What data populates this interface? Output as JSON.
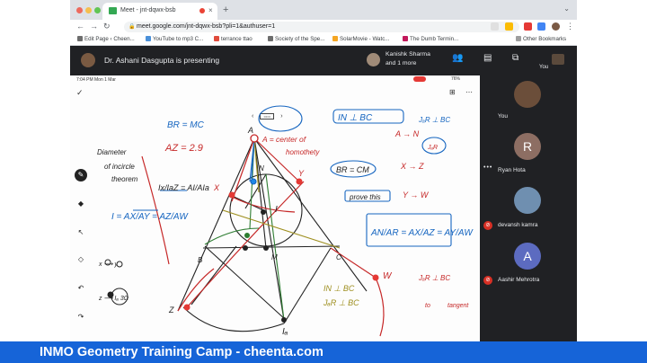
{
  "browser": {
    "tab_title": "Meet - jnt-dqwx-bsb",
    "tab_close": "×",
    "new_tab": "+",
    "url": "meet.google.com/jnt-dqwx-bsb?pli=1&authuser=1",
    "bookmarks": [
      {
        "label": "Edit Page ‹ Cheen...",
        "color": "#6d6d6d"
      },
      {
        "label": "YouTube to mp3 C...",
        "color": "#4a90d9"
      },
      {
        "label": "terrance ttao",
        "color": "#e04b3c"
      },
      {
        "label": "Society of the Spe...",
        "color": "#6d6d6d"
      },
      {
        "label": "SolarMovie - Watc...",
        "color": "#f5a623"
      },
      {
        "label": "The Dumb Termin...",
        "color": "#c2185b"
      }
    ],
    "other_bookmarks": "Other Bookmarks"
  },
  "meet": {
    "presenting_text": "Dr. Ashani Dasgupta is presenting",
    "pinned_line1": "Kanishk Sharma",
    "pinned_line2": "and 1 more",
    "you_label": "You",
    "participants": [
      {
        "name": "You",
        "initial": "",
        "muted": false,
        "avatar_color": "#6b4e3a"
      },
      {
        "name": "Ryan Hota",
        "initial": "R",
        "muted": false,
        "avatar_color": "#8d6e63"
      },
      {
        "name": "devansh kamra",
        "initial": "",
        "muted": true,
        "avatar_color": "#6f8fb0"
      },
      {
        "name": "Aashir Mehrotra",
        "initial": "A",
        "muted": true,
        "avatar_color": "#5c6bc0"
      }
    ]
  },
  "board": {
    "status_time": "7:04 PM   Mon 1 Mar",
    "battery": "76%",
    "pager_prev": "‹",
    "pager_next": "›",
    "notes": {
      "br_mc": "BR = MC",
      "az_val": "AZ = 2.9",
      "a_center": "A = center of",
      "homothety": "homothety",
      "br_cm": "BR = CM",
      "in_perp": "IN ⊥ BC",
      "ja_perp": "JₐR ⊥ BC",
      "a_to_n": "A → N",
      "x_to_z": "X → Z",
      "prove_this": "prove this",
      "y_to_w": "Y → W",
      "ja_label": "JₐR",
      "diameter": "Diameter",
      "of_incircle": "of incircle",
      "theorem": "theorem",
      "ix_frac": "Ix/IaZ = AI/AIa",
      "ax_frac": "I = AX/AY = AZ/AW",
      "an_ar": "AN/AR = AX/AZ = AY/AW",
      "in_bc2": "IN ⊥ BC",
      "jar_bc2": "JₐR ⊥ BC",
      "jar_bc3": "JₐR ⊥ BC",
      "tangent": "tangent",
      "to": "to",
      "ia_label": "Iₐ",
      "i_label": "I",
      "m_label": "M",
      "b_label": "B",
      "c_label": "C",
      "y_label": "Y",
      "x_label": "X",
      "w_label": "W",
      "z_label": "Z",
      "n_label": "N",
      "small_a": "A",
      "xy_note": "x ⟶ y",
      "za_note": "z ⟶ Iₐ 3Ω"
    }
  },
  "banner": {
    "text": "INMO Geometry Training Camp - cheenta.com"
  },
  "colors": {
    "brand_blue": "#1664d8",
    "meet_dark": "#202124",
    "ink_red": "#c62828",
    "ink_blue": "#1565c0",
    "ink_green": "#2e7d32",
    "ink_black": "#222222",
    "ink_olive": "#9e8f1f"
  }
}
